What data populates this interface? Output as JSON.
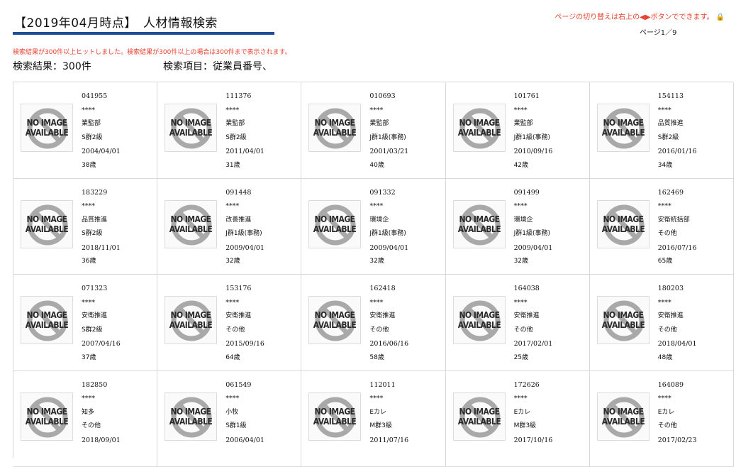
{
  "header": {
    "title": "【2019年04月時点】　人材情報検索",
    "page_switch_note": "ページの切り替えは右上の◀▶ボタンでできます。",
    "page_indicator": "ページ1／9"
  },
  "search": {
    "hit_notice": "検索結果が300件以上ヒットしました。検索結果が300件以上の場合は300件まで表示されます。",
    "result_count": "検索結果：300件",
    "search_fields": "検索項目：従業員番号、"
  },
  "photo_placeholder": {
    "line1": "NO IMAGE",
    "line2": "AVAILABLE"
  },
  "colors": {
    "accent_bar": "#1f4e99",
    "notice_red": "#e8402d"
  },
  "employees": [
    {
      "id": "041955",
      "name": "****",
      "dept": "業監部",
      "grade": "S群2級",
      "date": "2004/04/01",
      "age": "38歳"
    },
    {
      "id": "111376",
      "name": "****",
      "dept": "業監部",
      "grade": "S群2級",
      "date": "2011/04/01",
      "age": "31歳"
    },
    {
      "id": "010693",
      "name": "****",
      "dept": "業監部",
      "grade": "J群1級(事務)",
      "date": "2001/03/21",
      "age": "40歳"
    },
    {
      "id": "101761",
      "name": "****",
      "dept": "業監部",
      "grade": "J群1級(事務)",
      "date": "2010/09/16",
      "age": "42歳"
    },
    {
      "id": "154113",
      "name": "****",
      "dept": "品質推進",
      "grade": "S群2級",
      "date": "2016/01/16",
      "age": "34歳"
    },
    {
      "id": "183229",
      "name": "****",
      "dept": "品質推進",
      "grade": "S群2級",
      "date": "2018/11/01",
      "age": "36歳"
    },
    {
      "id": "091448",
      "name": "****",
      "dept": "改善推進",
      "grade": "J群1級(事務)",
      "date": "2009/04/01",
      "age": "32歳"
    },
    {
      "id": "091332",
      "name": "****",
      "dept": "環境企",
      "grade": "J群1級(事務)",
      "date": "2009/04/01",
      "age": "32歳"
    },
    {
      "id": "091499",
      "name": "****",
      "dept": "環境企",
      "grade": "J群1級(事務)",
      "date": "2009/04/01",
      "age": "32歳"
    },
    {
      "id": "162469",
      "name": "****",
      "dept": "安衛統括部",
      "grade": "その他",
      "date": "2016/07/16",
      "age": "65歳"
    },
    {
      "id": "071323",
      "name": "****",
      "dept": "安衛推進",
      "grade": "S群2級",
      "date": "2007/04/16",
      "age": "37歳"
    },
    {
      "id": "153176",
      "name": "****",
      "dept": "安衛推進",
      "grade": "その他",
      "date": "2015/09/16",
      "age": "64歳"
    },
    {
      "id": "162418",
      "name": "****",
      "dept": "安衛推進",
      "grade": "その他",
      "date": "2016/06/16",
      "age": "58歳"
    },
    {
      "id": "164038",
      "name": "****",
      "dept": "安衛推進",
      "grade": "その他",
      "date": "2017/02/01",
      "age": "25歳"
    },
    {
      "id": "180203",
      "name": "****",
      "dept": "安衛推進",
      "grade": "その他",
      "date": "2018/04/01",
      "age": "48歳"
    },
    {
      "id": "182850",
      "name": "****",
      "dept": "知多",
      "grade": "その他",
      "date": "2018/09/01",
      "age": ""
    },
    {
      "id": "061549",
      "name": "****",
      "dept": "小牧",
      "grade": "S群1級",
      "date": "2006/04/01",
      "age": ""
    },
    {
      "id": "112011",
      "name": "****",
      "dept": "Eカレ",
      "grade": "M群3級",
      "date": "2011/07/16",
      "age": ""
    },
    {
      "id": "172626",
      "name": "****",
      "dept": "Eカレ",
      "grade": "M群3級",
      "date": "2017/10/16",
      "age": ""
    },
    {
      "id": "164089",
      "name": "****",
      "dept": "Eカレ",
      "grade": "その他",
      "date": "2017/02/23",
      "age": ""
    }
  ]
}
